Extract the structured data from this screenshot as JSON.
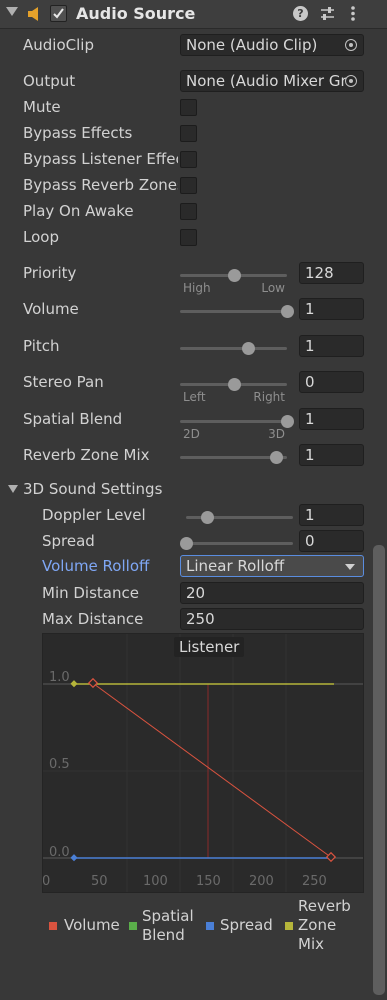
{
  "header": {
    "title": "Audio Source"
  },
  "fields": {
    "audioclip": {
      "label": "AudioClip",
      "value": "None (Audio Clip)"
    },
    "output": {
      "label": "Output",
      "value": "None (Audio Mixer Gr"
    },
    "mute": {
      "label": "Mute"
    },
    "bypass_effects": {
      "label": "Bypass Effects"
    },
    "bypass_listener": {
      "label": "Bypass Listener Effec"
    },
    "bypass_reverb": {
      "label": "Bypass Reverb Zones"
    },
    "play_on_awake": {
      "label": "Play On Awake"
    },
    "loop": {
      "label": "Loop"
    }
  },
  "sliders": {
    "priority": {
      "label": "Priority",
      "value": "128",
      "left": "High",
      "right": "Low",
      "fraction": 0.5
    },
    "volume": {
      "label": "Volume",
      "value": "1",
      "fraction": 1.0
    },
    "pitch": {
      "label": "Pitch",
      "value": "1",
      "fraction": 0.64
    },
    "stereo_pan": {
      "label": "Stereo Pan",
      "value": "0",
      "left": "Left",
      "right": "Right",
      "fraction": 0.5
    },
    "spatial_blend": {
      "label": "Spatial Blend",
      "value": "1",
      "left": "2D",
      "right": "3D",
      "fraction": 1.0
    },
    "reverb_zone_mix": {
      "label": "Reverb Zone Mix",
      "value": "1",
      "fraction": 0.9
    }
  },
  "sound3d": {
    "section_label": "3D Sound Settings",
    "doppler": {
      "label": "Doppler Level",
      "value": "1",
      "fraction": 0.2
    },
    "spread": {
      "label": "Spread",
      "value": "0",
      "fraction": 0.0
    },
    "rolloff": {
      "label": "Volume Rolloff",
      "value": "Linear Rolloff"
    },
    "min_distance": {
      "label": "Min Distance",
      "value": "20"
    },
    "max_distance": {
      "label": "Max Distance",
      "value": "250"
    }
  },
  "graph": {
    "listener_label": "Listener",
    "y_ticks": [
      "1.0",
      "0.5",
      "0.0"
    ],
    "x_ticks": [
      "0",
      "50",
      "100",
      "150",
      "200",
      "250"
    ]
  },
  "legend": [
    {
      "label": "Volume",
      "color": "#d9533f"
    },
    {
      "label": "Spatial Blend",
      "color": "#5aae4a"
    },
    {
      "label": "Spread",
      "color": "#4a7fd6"
    },
    {
      "label": "Reverb Zone Mix",
      "color": "#b5b53a"
    }
  ],
  "colors": {
    "accent_label": "#7fa7f5",
    "bg": "#383838"
  }
}
